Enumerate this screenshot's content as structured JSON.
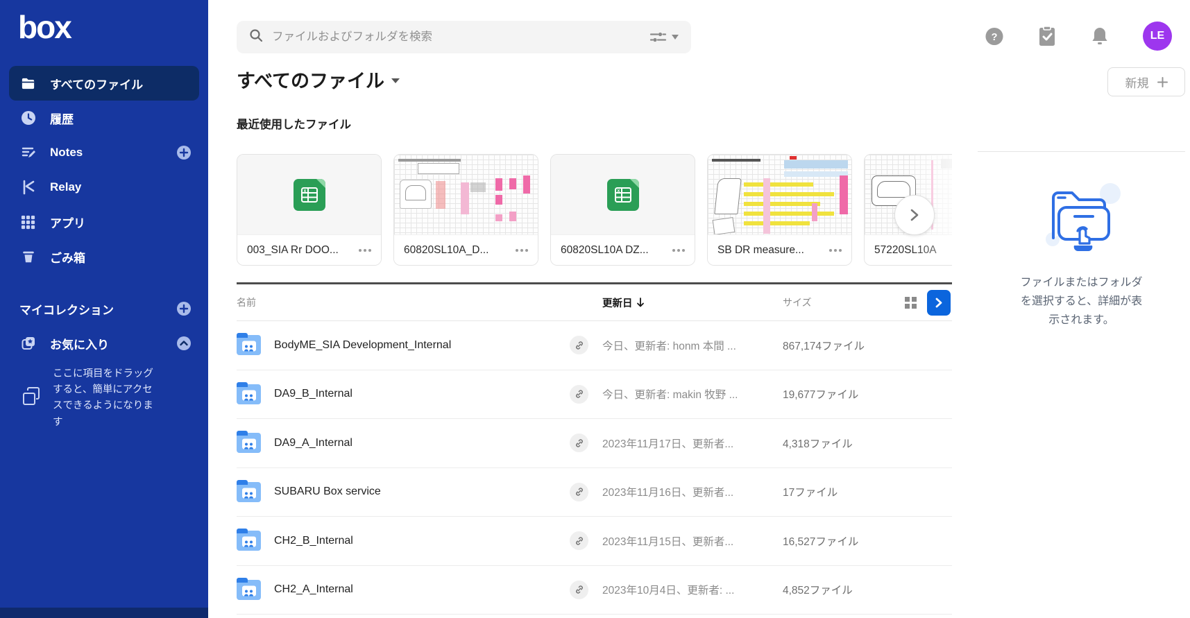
{
  "brand": {
    "logo_text": "box"
  },
  "colors": {
    "sidebar_bg": "#17379f",
    "sidebar_active_bg": "#0d2c66",
    "accent_blue": "#0b65dd",
    "folder_blue": "#85bcf9",
    "avatar_purple": "#9d36ee",
    "excel_green": "#2a9e56"
  },
  "sidebar": {
    "nav": [
      {
        "label": "すべてのファイル",
        "icon": "folder-icon",
        "active": true
      },
      {
        "label": "履歴",
        "icon": "clock-icon",
        "active": false
      },
      {
        "label": "Notes",
        "icon": "notes-icon",
        "active": false,
        "plus": true
      },
      {
        "label": "Relay",
        "icon": "relay-icon",
        "active": false
      },
      {
        "label": "アプリ",
        "icon": "apps-grid-icon",
        "active": false
      },
      {
        "label": "ごみ箱",
        "icon": "trash-icon",
        "active": false
      }
    ],
    "collections": {
      "header": "マイコレクション",
      "favorites": "お気に入り",
      "drag_hint": "ここに項目をドラッグすると、簡単にアクセスできるようになります"
    }
  },
  "topbar": {
    "search_placeholder": "ファイルおよびフォルダを検索",
    "avatar_initials": "LE"
  },
  "page": {
    "title": "すべてのファイル",
    "new_button_label": "新規"
  },
  "recent": {
    "title": "最近使用したファイル",
    "cards": [
      {
        "name": "003_SIA Rr DOO...",
        "type": "excel"
      },
      {
        "name": "60820SL10A_D...",
        "type": "spreadsheet-thumbnail"
      },
      {
        "name": "60820SL10A DZ...",
        "type": "excel"
      },
      {
        "name": "SB DR measure...",
        "type": "spreadsheet-thumbnail"
      },
      {
        "name": "57220SL10A",
        "type": "spreadsheet-thumbnail"
      }
    ]
  },
  "table": {
    "header": {
      "name": "名前",
      "modified": "更新日",
      "size": "サイズ"
    },
    "sort": {
      "column": "更新日",
      "direction": "desc"
    },
    "rows": [
      {
        "name": "BodyME_SIA Development_Internal",
        "modified": "今日、更新者: honm 本間 ...",
        "size": "867,174ファイル"
      },
      {
        "name": "DA9_B_Internal",
        "modified": "今日、更新者: makin 牧野 ...",
        "size": "19,677ファイル"
      },
      {
        "name": "DA9_A_Internal",
        "modified": "2023年11月17日、更新者...",
        "size": "4,318ファイル"
      },
      {
        "name": "SUBARU Box service",
        "modified": "2023年11月16日、更新者...",
        "size": "17ファイル"
      },
      {
        "name": "CH2_B_Internal",
        "modified": "2023年11月15日、更新者...",
        "size": "16,527ファイル"
      },
      {
        "name": "CH2_A_Internal",
        "modified": "2023年10月4日、更新者: ...",
        "size": "4,852ファイル"
      }
    ]
  },
  "details_panel": {
    "empty_text": "ファイルまたはフォルダを選択すると、詳細が表示されます。"
  }
}
